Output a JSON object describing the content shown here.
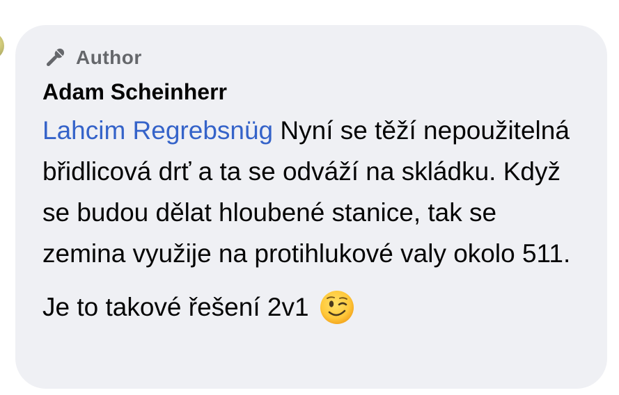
{
  "comment": {
    "badge": {
      "icon": "microphone-icon",
      "label": "Author"
    },
    "author_name": "Adam Scheinherr",
    "mention": "Lahcim Regrebsnüg",
    "body_paragraph_1": " Nyní se těží nepoužitelná břidlicová drť a ta se odváží na skládku. Když se budou dělat hloubené stanice, tak se zemina využije na protihlukové valy okolo 511.",
    "body_paragraph_2": "Je to takové řešení 2v1",
    "emoji": "winking-face-emoji"
  },
  "colors": {
    "bubble_background": "#eff0f4",
    "mention": "#3563c9",
    "badge_text": "#65676b",
    "text": "#050505"
  }
}
